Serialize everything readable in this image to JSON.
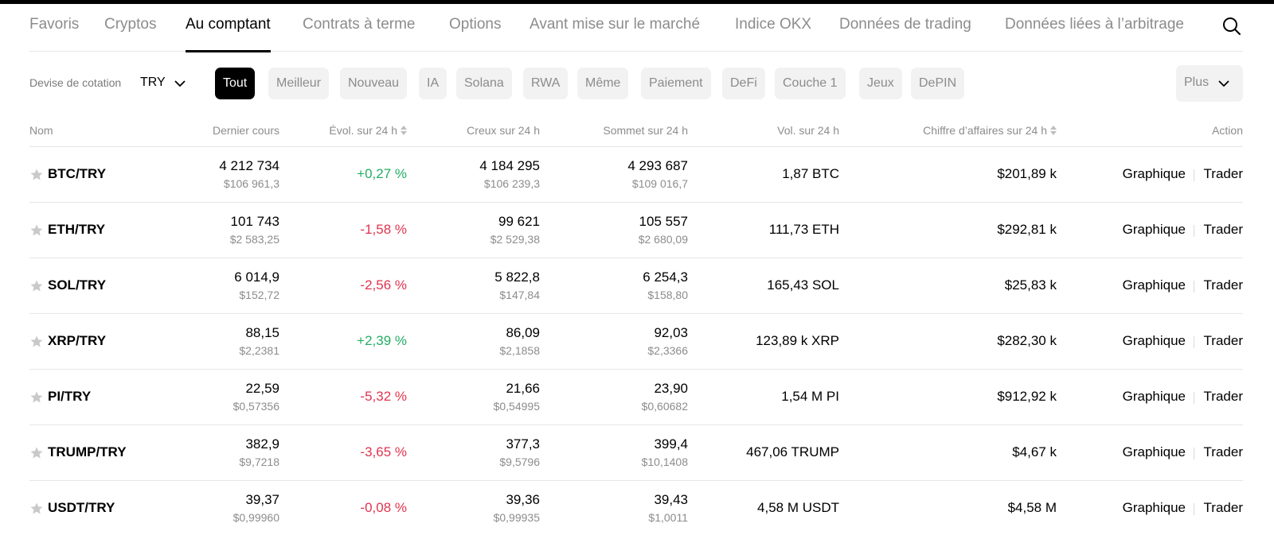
{
  "tabs": [
    {
      "label": "Favoris",
      "active": false
    },
    {
      "label": "Cryptos",
      "active": false
    },
    {
      "label": "Au comptant",
      "active": true
    },
    {
      "label": "Contrats à terme",
      "active": false
    },
    {
      "label": "Options",
      "active": false
    },
    {
      "label": "Avant mise sur le marché",
      "active": false
    },
    {
      "label": "Indice OKX",
      "active": false
    },
    {
      "label": "Données de trading",
      "active": false
    },
    {
      "label": "Données liées à l’arbitrage",
      "active": false
    }
  ],
  "search_icon": "search-icon",
  "filters": {
    "quote_label": "Devise de cotation",
    "quote_value": "TRY",
    "chips": [
      "Tout",
      "Meilleur",
      "Nouveau",
      "IA",
      "Solana",
      "RWA",
      "Même",
      "Paiement",
      "DeFi",
      "Couche 1",
      "Jeux",
      "DePIN"
    ],
    "active_chip": "Tout",
    "more_label": "Plus"
  },
  "columns": {
    "name": "Nom",
    "last": "Dernier cours",
    "change": "Évol. sur 24 h",
    "low": "Creux sur 24 h",
    "high": "Sommet sur 24 h",
    "volume": "Vol. sur 24 h",
    "turnover": "Chiffre d’affaires sur 24 h",
    "action": "Action"
  },
  "actions": {
    "chart": "Graphique",
    "trade": "Trader"
  },
  "colors": {
    "positive": "#24ae64",
    "negative": "#e0344f"
  },
  "rows": [
    {
      "pair": "BTC/TRY",
      "last": "4 212 734",
      "last_usd": "$106 961,3",
      "change": "+0,27 %",
      "low": "4 184 295",
      "low_usd": "$106 239,3",
      "high": "4 293 687",
      "high_usd": "$109 016,7",
      "volume": "1,87 BTC",
      "turnover": "$201,89 k"
    },
    {
      "pair": "ETH/TRY",
      "last": "101 743",
      "last_usd": "$2 583,25",
      "change": "-1,58 %",
      "low": "99 621",
      "low_usd": "$2 529,38",
      "high": "105 557",
      "high_usd": "$2 680,09",
      "volume": "111,73 ETH",
      "turnover": "$292,81 k"
    },
    {
      "pair": "SOL/TRY",
      "last": "6 014,9",
      "last_usd": "$152,72",
      "change": "-2,56 %",
      "low": "5 822,8",
      "low_usd": "$147,84",
      "high": "6 254,3",
      "high_usd": "$158,80",
      "volume": "165,43 SOL",
      "turnover": "$25,83 k"
    },
    {
      "pair": "XRP/TRY",
      "last": "88,15",
      "last_usd": "$2,2381",
      "change": "+2,39 %",
      "low": "86,09",
      "low_usd": "$2,1858",
      "high": "92,03",
      "high_usd": "$2,3366",
      "volume": "123,89 k XRP",
      "turnover": "$282,30 k"
    },
    {
      "pair": "PI/TRY",
      "last": "22,59",
      "last_usd": "$0,57356",
      "change": "-5,32 %",
      "low": "21,66",
      "low_usd": "$0,54995",
      "high": "23,90",
      "high_usd": "$0,60682",
      "volume": "1,54 M PI",
      "turnover": "$912,92 k"
    },
    {
      "pair": "TRUMP/TRY",
      "last": "382,9",
      "last_usd": "$9,7218",
      "change": "-3,65 %",
      "low": "377,3",
      "low_usd": "$9,5796",
      "high": "399,4",
      "high_usd": "$10,1408",
      "volume": "467,06 TRUMP",
      "turnover": "$4,67 k"
    },
    {
      "pair": "USDT/TRY",
      "last": "39,37",
      "last_usd": "$0,99960",
      "change": "-0,08 %",
      "low": "39,36",
      "low_usd": "$0,99935",
      "high": "39,43",
      "high_usd": "$1,0011",
      "volume": "4,58 M USDT",
      "turnover": "$4,58 M"
    }
  ]
}
